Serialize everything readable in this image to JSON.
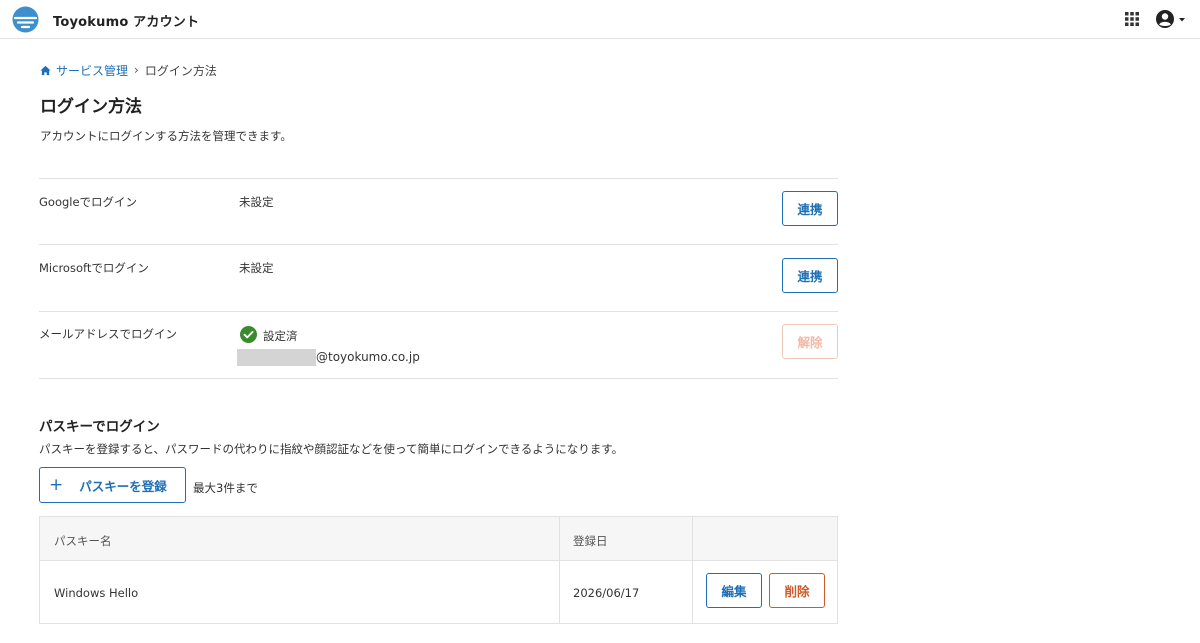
{
  "header": {
    "app_title": "Toyokumo アカウント",
    "apps_icon": "grid-icon",
    "account_icon": "user-circle-icon"
  },
  "breadcrumb": {
    "parent": "サービス管理",
    "separator": "›",
    "current": "ログイン方法"
  },
  "page": {
    "title": "ログイン方法",
    "description": "アカウントにログインする方法を管理できます。"
  },
  "methods": [
    {
      "label": "Googleでログイン",
      "status": "未設定",
      "action": "連携"
    },
    {
      "label": "Microsoftでログイン",
      "status": "未設定",
      "action": "連携"
    },
    {
      "label": "メールアドレスでログイン",
      "status": "設定済",
      "email_domain": "@toyokumo.co.jp",
      "action": "解除"
    }
  ],
  "passkey": {
    "title": "パスキーでログイン",
    "description": "パスキーを登録すると、パスワードの代わりに指紋や顔認証などを使って簡単にログインできるようになります。",
    "register_label": "パスキーを登録",
    "limit_text": "最大3件まで",
    "columns": [
      "パスキー名",
      "登録日",
      ""
    ],
    "rows": [
      {
        "name": "Windows Hello",
        "date": "2026/06/17",
        "edit": "編集",
        "delete": "削除"
      }
    ]
  },
  "colors": {
    "primary": "#1f6fb5",
    "danger": "#cf5a2c",
    "success": "#3a8a2e"
  }
}
